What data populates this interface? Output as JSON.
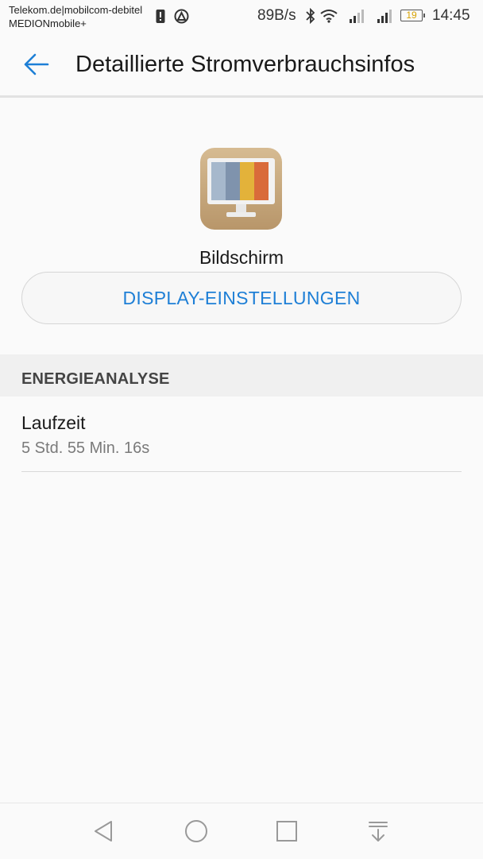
{
  "status_bar": {
    "carrier_line1": "Telekom.de|mobilcom-debitel",
    "carrier_line2": "MEDIONmobile+",
    "net_speed": "89B/s",
    "battery_level": "19",
    "time": "14:45",
    "icons": [
      "alert-icon",
      "vpn-icon",
      "bluetooth-icon",
      "wifi-icon",
      "signal-icon",
      "signal-icon",
      "battery-icon"
    ]
  },
  "app_bar": {
    "title": "Detaillierte Stromverbrauchsinfos",
    "back_icon": "arrow-left-icon"
  },
  "app_header": {
    "icon": "display-monitor-icon",
    "name": "Bildschirm",
    "settings_button": "DISPLAY-EINSTELLUNGEN"
  },
  "energy_analysis": {
    "section_title": "ENERGIEANALYSE",
    "items": [
      {
        "label": "Laufzeit",
        "value": "5 Std. 55 Min. 16s"
      }
    ]
  },
  "nav_bar": {
    "icons": [
      "back-triangle-icon",
      "home-circle-icon",
      "recents-square-icon",
      "notification-pull-icon"
    ]
  },
  "colors": {
    "accent": "#1e7fd6",
    "background": "#fafafa",
    "section_background": "#f0f0f0",
    "battery_text": "#d8a200"
  }
}
